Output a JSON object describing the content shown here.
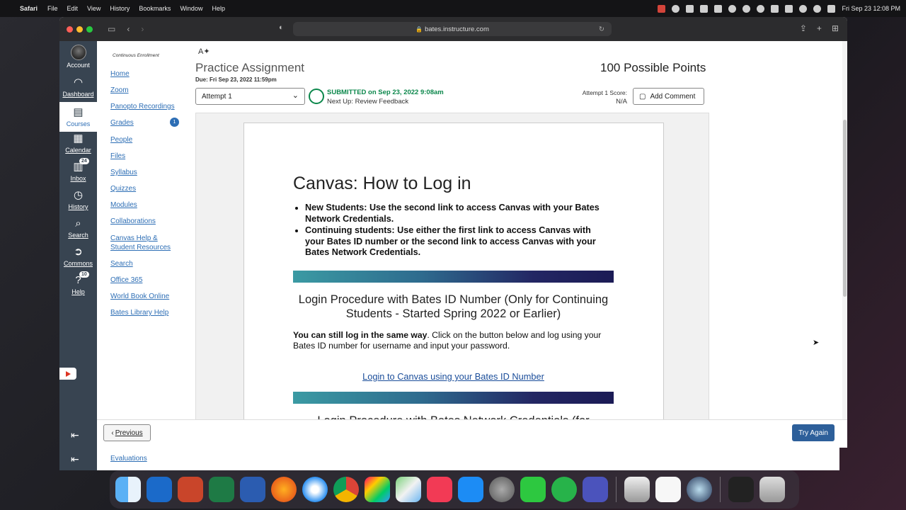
{
  "menubar": {
    "app_name": "Safari",
    "menus": [
      "File",
      "Edit",
      "View",
      "History",
      "Bookmarks",
      "Window",
      "Help"
    ],
    "datetime": "Fri Sep 23  12:08 PM"
  },
  "browser": {
    "url": "bates.instructure.com"
  },
  "global_nav": {
    "items": [
      {
        "label": "Account",
        "icon": "avatar"
      },
      {
        "label": "Dashboard",
        "icon": "speedometer-icon"
      },
      {
        "label": "Courses",
        "icon": "book-icon"
      },
      {
        "label": "Calendar",
        "icon": "calendar-icon"
      },
      {
        "label": "Inbox",
        "icon": "inbox-icon",
        "badge": "24"
      },
      {
        "label": "History",
        "icon": "clock-icon"
      },
      {
        "label": "Search",
        "icon": "search-icon"
      },
      {
        "label": "Commons",
        "icon": "commons-icon"
      },
      {
        "label": "Help",
        "icon": "help-icon",
        "badge": "10"
      }
    ]
  },
  "course_nav": {
    "enrollment_label": "Continuous Enrollment",
    "items": [
      "Home",
      "Zoom",
      "Panopto Recordings",
      "Grades",
      "People",
      "Files",
      "Syllabus",
      "Quizzes",
      "Modules",
      "Collaborations",
      "Canvas Help & Student Resources",
      "Search",
      "Office 365",
      "World Book Online",
      "Bates Library Help"
    ],
    "grades_badge": "1"
  },
  "assignment": {
    "title": "Practice Assignment",
    "points": "100 Possible Points",
    "due": "Due: Fri Sep 23, 2022 11:59pm",
    "attempt_select": "Attempt 1",
    "status": "SUBMITTED on Sep 23, 2022 9:08am",
    "next_up": "Next Up: Review Feedback",
    "score_label": "Attempt 1 Score:",
    "score_value": "N/A",
    "add_comment": "Add Comment"
  },
  "document": {
    "title": "Canvas: How to Log in",
    "bullets": [
      "New Students: Use the second link to access Canvas with your Bates Network Credentials.",
      "Continuing students:  Use either the first link to access Canvas with your Bates ID number or the second link to access Canvas with your Bates Network Credentials."
    ],
    "section1_heading": "Login Procedure with Bates ID Number (Only for Continuing Students - Started Spring 2022 or Earlier)",
    "section1_bold": "You can still log in the same way",
    "section1_text": ".  Click on the button below and log using your Bates ID number for username and input your password.",
    "section1_link": "Login to Canvas using your Bates ID Number",
    "section2_heading": "Login Procedure with Bates Network Credentials (for"
  },
  "footer": {
    "previous": "Previous",
    "try_again": "Try Again"
  },
  "behind_window": {
    "link": "Evaluations"
  },
  "dock": {
    "apps": [
      "finder",
      "outlook",
      "powerpoint",
      "excel",
      "word",
      "firefox",
      "safari",
      "chrome",
      "launchpad",
      "maps",
      "music",
      "app-store",
      "system-preferences",
      "facetime",
      "evernote",
      "teams",
      "preview",
      "reminders",
      "quicktime",
      "screen",
      "trash"
    ]
  }
}
